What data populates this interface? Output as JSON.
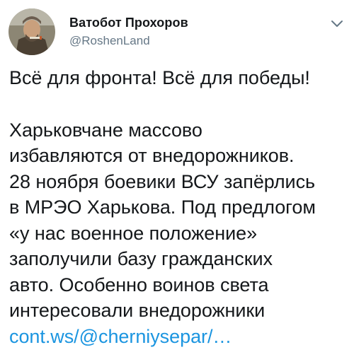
{
  "user": {
    "display_name": "Ватобот Прохоров",
    "handle": "@RoshenLand"
  },
  "tweet": {
    "headline": "Всё для фронта! Всё для победы!",
    "lines": [
      "Харьковчане массово",
      "избавляются от внедорожников.",
      "28 ноября боевики ВСУ запёрлись",
      "в МРЭО Харькова. Под предлогом",
      "«у нас военное положение»",
      "заполучили базу гражданских",
      "авто. Особенно воинов света",
      "интересовали внедорожники"
    ],
    "link": "cont.ws/@cherniysepar/…"
  },
  "icons": {
    "menu": "chevron-down-icon"
  },
  "colors": {
    "text": "#14171a",
    "secondary": "#657786",
    "link": "#1b95e0",
    "background": "#ffffff"
  }
}
